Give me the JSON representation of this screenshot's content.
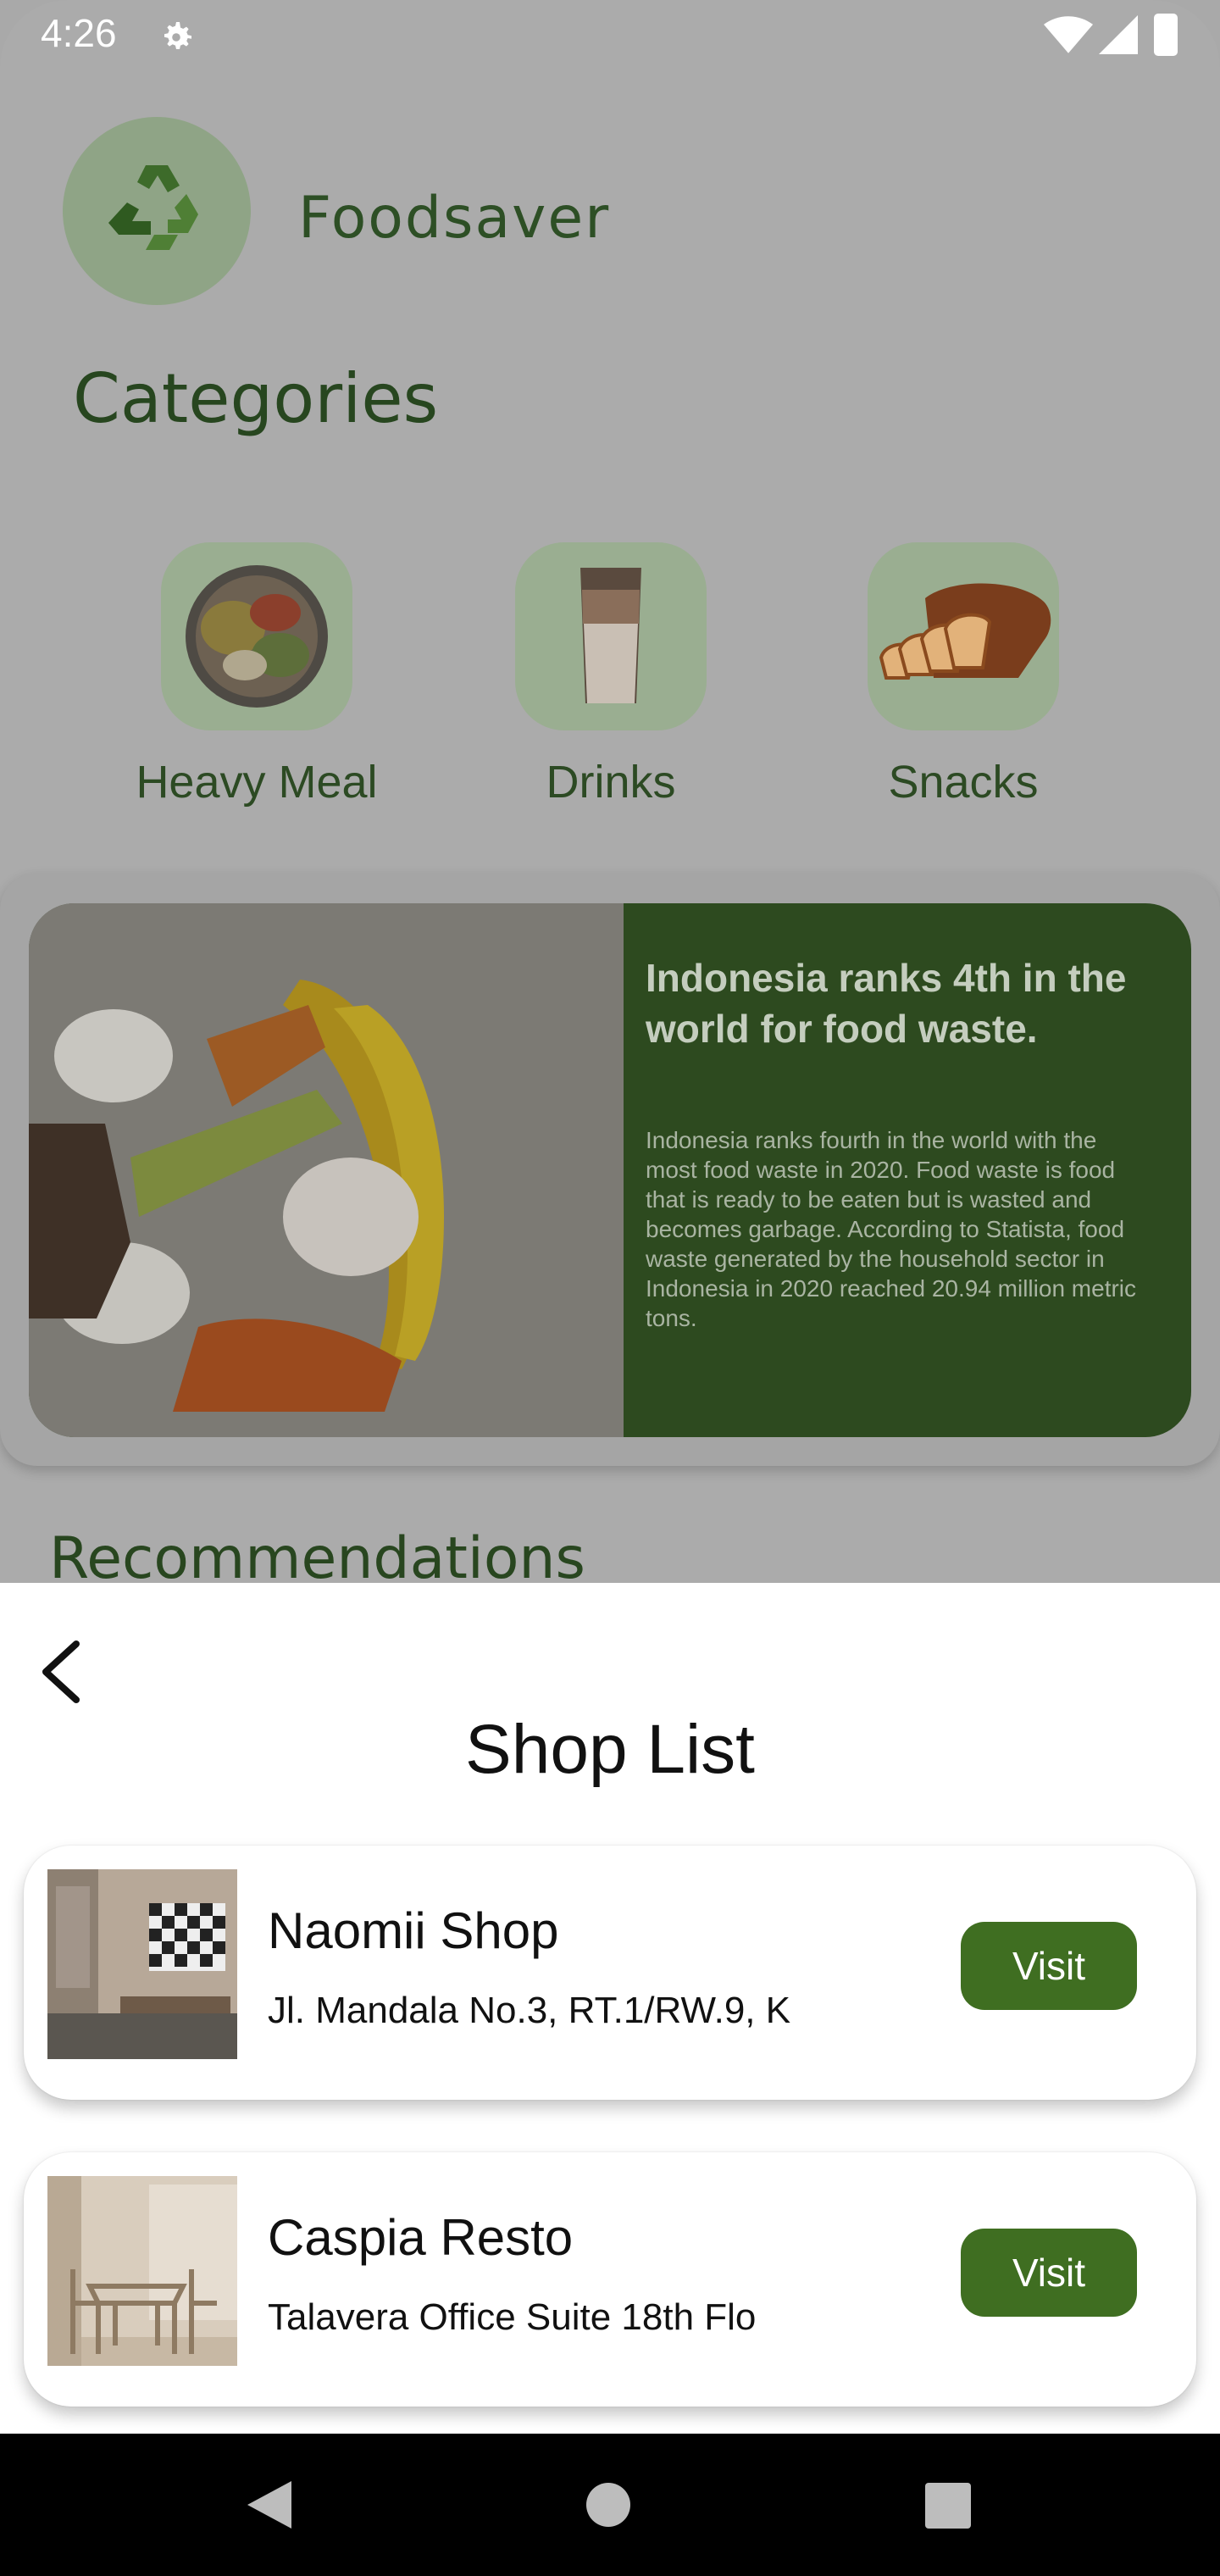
{
  "status_bar": {
    "time": "4:26"
  },
  "header": {
    "app_name": "Foodsaver"
  },
  "categories": {
    "title": "Categories",
    "items": [
      {
        "label": "Heavy Meal"
      },
      {
        "label": "Drinks"
      },
      {
        "label": "Snacks"
      }
    ]
  },
  "banner": {
    "title": "Indonesia ranks 4th in the world for food waste.",
    "body": "Indonesia ranks fourth in the world with the most food waste in 2020. Food waste is food that is ready to be eaten but is wasted and becomes garbage. According to Statista, food waste generated by the household sector in Indonesia in 2020 reached 20.94 million metric tons."
  },
  "recommendations": {
    "title": "Recommendations"
  },
  "sheet": {
    "title": "Shop List",
    "shops": [
      {
        "name": "Naomii Shop",
        "address": "Jl. Mandala No.3, RT.1/RW.9, K",
        "visit_label": "Visit"
      },
      {
        "name": "Caspia Resto",
        "address": "Talavera Office Suite 18th Flo",
        "visit_label": "Visit"
      }
    ]
  },
  "colors": {
    "brand_green": "#3f6e21",
    "banner_green": "#2d4a1f",
    "scrim": "#ababab"
  }
}
